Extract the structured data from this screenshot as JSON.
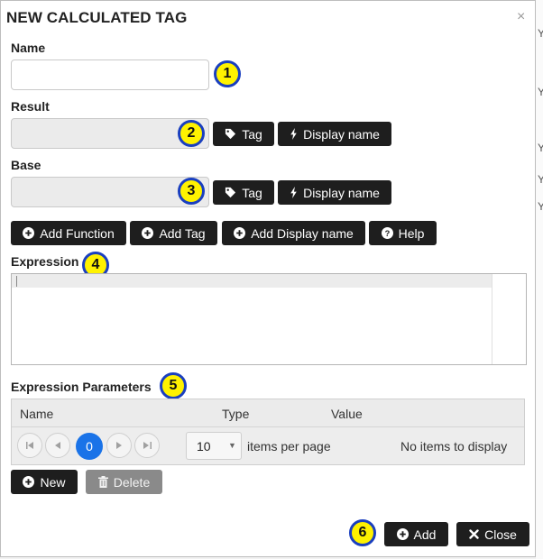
{
  "dialog": {
    "title": "NEW CALCULATED TAG",
    "close_glyph": "×",
    "close_icon": "close-icon"
  },
  "background_letters": [
    "Y",
    "Y",
    "Y",
    "Y",
    "Y"
  ],
  "fields": {
    "name": {
      "label": "Name",
      "value": "",
      "placeholder": ""
    },
    "result": {
      "label": "Result",
      "value": "",
      "disabled": true
    },
    "base": {
      "label": "Base",
      "value": "",
      "disabled": true
    }
  },
  "buttons": {
    "result_tag": {
      "label": "Tag",
      "icon": "tag-icon"
    },
    "result_display": {
      "label": "Display name",
      "icon": "bolt-icon"
    },
    "base_tag": {
      "label": "Tag",
      "icon": "tag-icon"
    },
    "base_display": {
      "label": "Display name",
      "icon": "bolt-icon"
    },
    "add_function": {
      "label": "Add Function",
      "icon": "plus-circle-icon"
    },
    "add_tag": {
      "label": "Add Tag",
      "icon": "plus-circle-icon"
    },
    "add_display": {
      "label": "Add Display name",
      "icon": "plus-circle-icon"
    },
    "help": {
      "label": "Help",
      "icon": "question-circle-icon"
    },
    "new": {
      "label": "New",
      "icon": "plus-circle-icon"
    },
    "delete": {
      "label": "Delete",
      "icon": "trash-icon"
    },
    "add": {
      "label": "Add",
      "icon": "plus-circle-icon"
    },
    "close": {
      "label": "Close",
      "icon": "x-icon"
    }
  },
  "expression": {
    "label": "Expression",
    "value": ""
  },
  "parameters": {
    "label": "Expression Parameters",
    "columns": [
      "Name",
      "Type",
      "Value"
    ],
    "pager": {
      "current_page": "0",
      "page_size": "10",
      "page_size_suffix": "items per page",
      "empty_message": "No items to display"
    }
  },
  "badges": [
    "1",
    "2",
    "3",
    "4",
    "5",
    "6"
  ],
  "colors": {
    "button_dark": "#1e1e1e",
    "button_disabled": "#8a8a8a",
    "badge_fill": "#fff200",
    "badge_border": "#1a3fbf",
    "pager_current": "#1a73e8"
  }
}
